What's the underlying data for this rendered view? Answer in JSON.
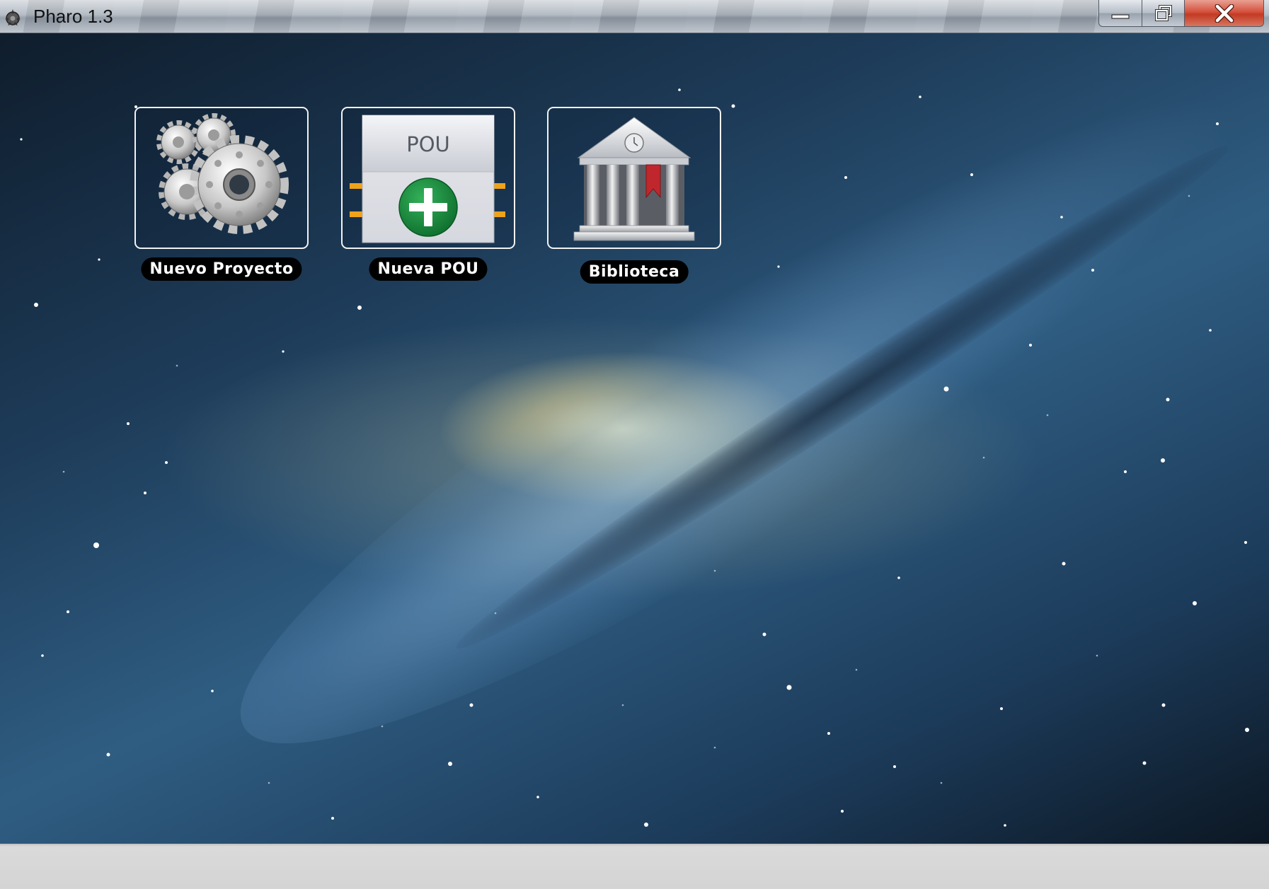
{
  "window": {
    "title": "Pharo 1.3",
    "app_icon": "pharo-lighthouse-icon",
    "controls": [
      "minimize-icon",
      "restore-icon",
      "close-icon"
    ]
  },
  "desktop": {
    "wallpaper": "galaxy",
    "icons": [
      {
        "label": "Nuevo Proyecto",
        "icon": "gears-icon"
      },
      {
        "label": "Nueva POU",
        "icon": "pou-add-icon",
        "inner_text": "POU"
      },
      {
        "label": "Biblioteca",
        "icon": "library-building-icon"
      }
    ]
  },
  "colors": {
    "label_bg": "#000000",
    "label_fg": "#ffffff",
    "close_red": "#c9432c",
    "plus_green": "#1c8a3e",
    "pin_orange": "#f0a21a"
  }
}
